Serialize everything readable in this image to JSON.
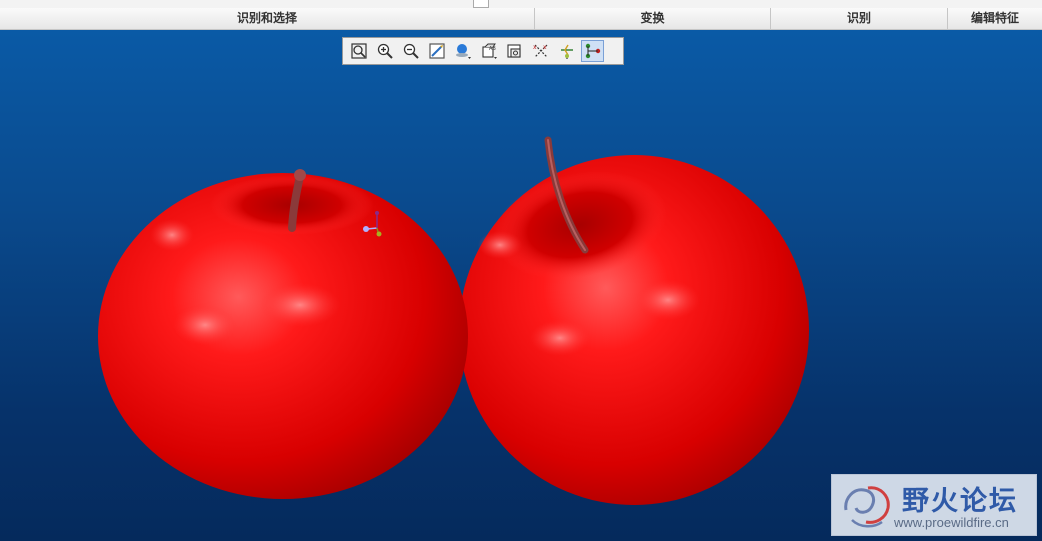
{
  "ribbon": {
    "groups": [
      {
        "label": "识别和选择"
      },
      {
        "label": "变换"
      },
      {
        "label": "识别"
      },
      {
        "label": "编辑特征"
      }
    ]
  },
  "graphics_toolbar": {
    "buttons": [
      {
        "name": "refit-icon"
      },
      {
        "name": "zoom-in-icon"
      },
      {
        "name": "zoom-out-icon"
      },
      {
        "name": "repaint-icon"
      },
      {
        "name": "display-style-icon"
      },
      {
        "name": "saved-orientations-icon"
      },
      {
        "name": "view-manager-icon"
      },
      {
        "name": "datum-display-icon"
      },
      {
        "name": "spin-center-icon"
      },
      {
        "name": "annotation-display-icon"
      }
    ]
  },
  "colors": {
    "viewport_top": "#0a5aa6",
    "viewport_bottom": "#052a5c",
    "apple_red": "#e00000",
    "stem": "#8a3a3a"
  },
  "watermark": {
    "title": "野火论坛",
    "url": "www.proewildfire.cn"
  }
}
